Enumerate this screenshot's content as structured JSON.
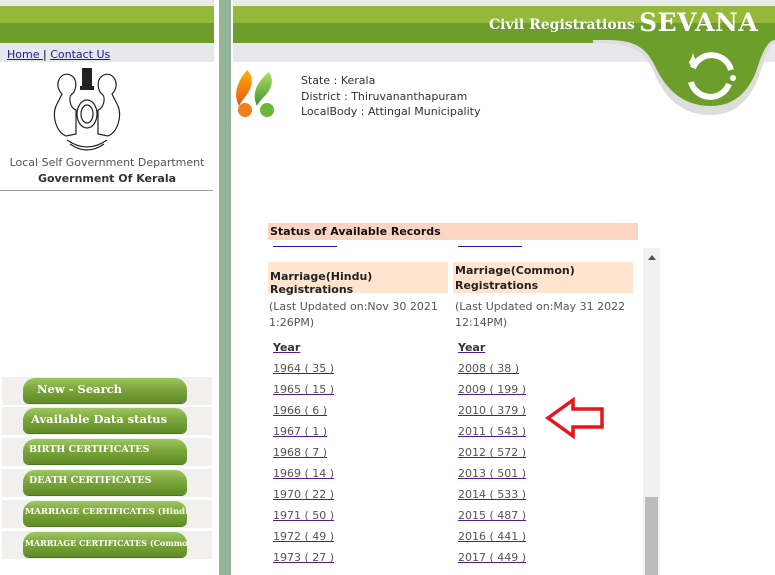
{
  "left": {
    "links": [
      {
        "label": "Home "
      },
      {
        "label": "Contact Us"
      }
    ],
    "link_separator": "|",
    "department": "Local Self Government Department",
    "government": "Government Of Kerala",
    "menu": [
      {
        "label": "New - Search"
      },
      {
        "label": "Available Data status"
      },
      {
        "label": "BIRTH CERTIFICATES"
      },
      {
        "label": "DEATH CERTIFICATES"
      },
      {
        "label": "MARRIAGE CERTIFICATES (Hindu)"
      },
      {
        "label": "MARRIAGE CERTIFICATES (Common)"
      }
    ]
  },
  "header": {
    "subtitle": "Civil Registrations",
    "brand": "SEVANA",
    "brand_color": "#6d9e2b"
  },
  "location": {
    "state": "State : Kerala",
    "district": "District : Thiruvananthapuram",
    "localbody": "LocalBody : Attingal Municipality"
  },
  "records": {
    "title": "Status of Available Records",
    "columns": [
      {
        "heading": "Marriage(Hindu) Registrations",
        "updated_line1": "(Last Updated on:Nov 30 2021",
        "updated_line2": "1:26PM)",
        "year_label": "Year",
        "rows": [
          "1964 ( 35 )",
          "1965 ( 15 )",
          "1966 ( 6 )",
          "1967 ( 1 )",
          "1968 ( 7 )",
          "1969 ( 14 )",
          "1970 ( 22 )",
          "1971 ( 50 )",
          "1972 ( 49 )",
          "1973 ( 27 )"
        ]
      },
      {
        "heading": "Marriage(Common) Registrations",
        "updated_line1": "(Last Updated on:May 31 2022",
        "updated_line2": "12:14PM)",
        "year_label": "Year",
        "rows": [
          "2008 ( 38 )",
          "2009 ( 199 )",
          "2010 ( 379 )",
          "2011 ( 543 )",
          "2012 ( 572 )",
          "2013 ( 501 )",
          "2014 ( 533 )",
          "2015 ( 487 )",
          "2016 ( 441 )",
          "2017 ( 449 )"
        ]
      }
    ]
  },
  "annotation": {
    "arrow_color": "#e8141c"
  }
}
